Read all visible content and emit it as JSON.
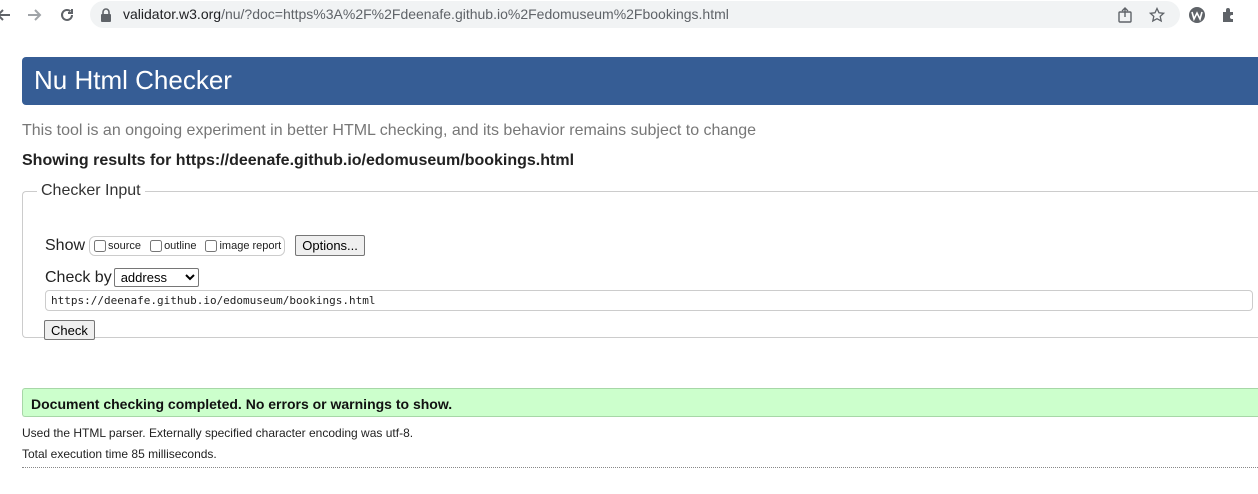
{
  "browser": {
    "url_host": "validator.w3.org",
    "url_rest": "/nu/?doc=https%3A%2F%2Fdeenafe.github.io%2Fedomuseum%2Fbookings.html",
    "icons": [
      "back-icon",
      "forward-icon",
      "reload-icon",
      "lock-icon",
      "share-icon",
      "star-icon",
      "extension-w-icon",
      "puzzle-icon"
    ]
  },
  "header": {
    "title": "Nu Html Checker"
  },
  "subtitle": "This tool is an ongoing experiment in better HTML checking, and its behavior remains subject to change",
  "results_for": "Showing results for https://deenafe.github.io/edomuseum/bookings.html",
  "checker": {
    "legend": "Checker Input",
    "show_label": "Show",
    "show_options": [
      {
        "label": "source",
        "checked": false
      },
      {
        "label": "outline",
        "checked": false
      },
      {
        "label": "image report",
        "checked": false
      }
    ],
    "options_button": "Options...",
    "check_by_label": "Check by",
    "check_by_selected": "address",
    "doc_value": "https://deenafe.github.io/edomuseum/bookings.html",
    "check_button": "Check"
  },
  "result": {
    "success_message": "Document checking completed. No errors or warnings to show.",
    "parser_note": "Used the HTML parser. Externally specified character encoding was utf-8.",
    "exec_time": "Total execution time 85 milliseconds."
  },
  "colors": {
    "header_bg": "#365d95",
    "success_bg": "#ccffcc"
  }
}
